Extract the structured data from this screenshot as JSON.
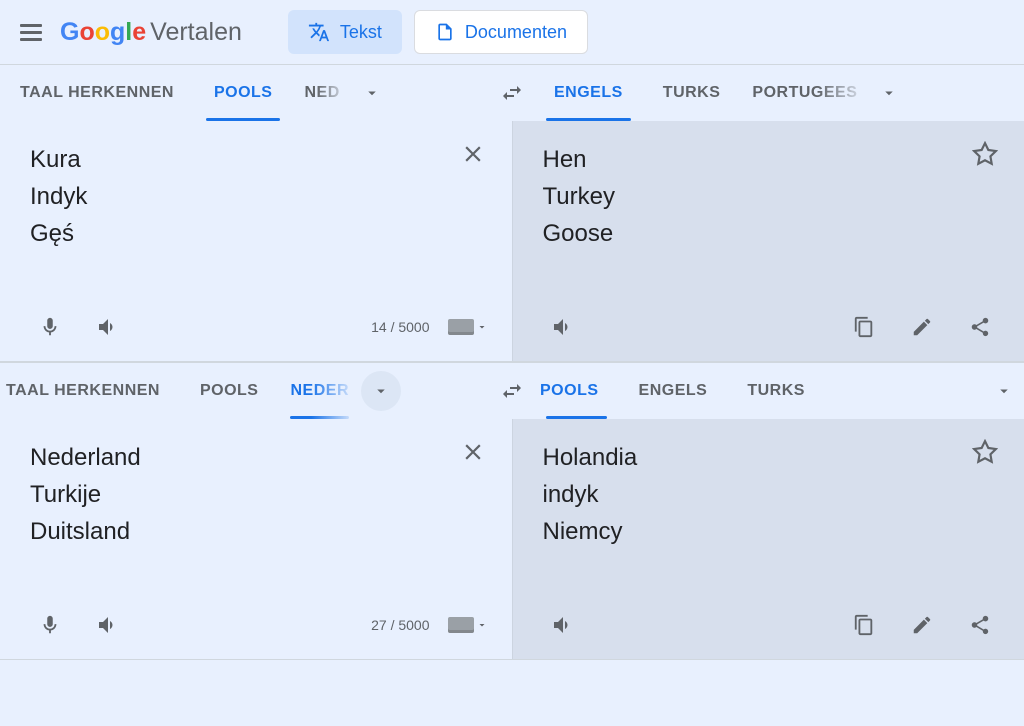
{
  "header": {
    "logo_suffix": "Vertalen",
    "text_mode": "Tekst",
    "documents_mode": "Documenten"
  },
  "block1": {
    "source_tabs": {
      "detect": "TAAL HERKENNEN",
      "active": "POOLS",
      "third": "NED"
    },
    "target_tabs": {
      "active": "ENGELS",
      "second": "TURKS",
      "third": "PORTUGEES"
    },
    "source_text": "Kura\nIndyk\nGęś",
    "target_text": "Hen\nTurkey\nGoose",
    "char_count": "14 / 5000"
  },
  "block2": {
    "source_tabs": {
      "detect": "TAAL HERKENNEN",
      "second": "POOLS",
      "active": "NEDER"
    },
    "target_tabs": {
      "active": "POOLS",
      "second": "ENGELS",
      "third": "TURKS"
    },
    "source_text": "Nederland\nTurkije\nDuitsland",
    "target_text": "Holandia\nindyk\nNiemcy",
    "char_count": "27 / 5000"
  }
}
